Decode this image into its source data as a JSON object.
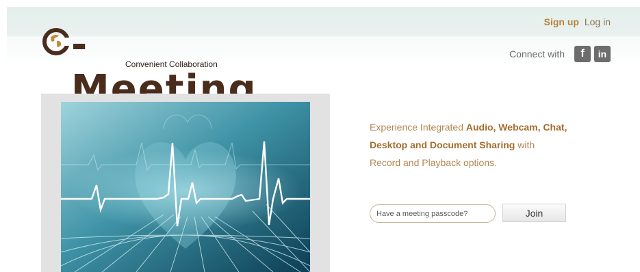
{
  "brand": {
    "name": "C-Meeting",
    "logo_text": "-Meeting",
    "tagline": "Convenient Collaboration"
  },
  "auth": {
    "signup_label": "Sign up",
    "login_label": "Log in"
  },
  "connect": {
    "label": "Connect with",
    "facebook_glyph": "f",
    "linkedin_glyph": "in"
  },
  "hero": {
    "intro": "Experience Integrated ",
    "feature_list": "Audio, Webcam, Chat, Desktop and Document Sharing",
    "middle": " with",
    "closing": "Record and Playback options."
  },
  "join": {
    "placeholder": "Have a meeting passcode?",
    "button_label": "Join"
  },
  "colors": {
    "brand_brown": "#4a2c1d",
    "accent_gold": "#b6843b",
    "text_gold": "#b28650"
  },
  "icons": [
    "globe-icon",
    "facebook-icon",
    "linkedin-icon"
  ]
}
